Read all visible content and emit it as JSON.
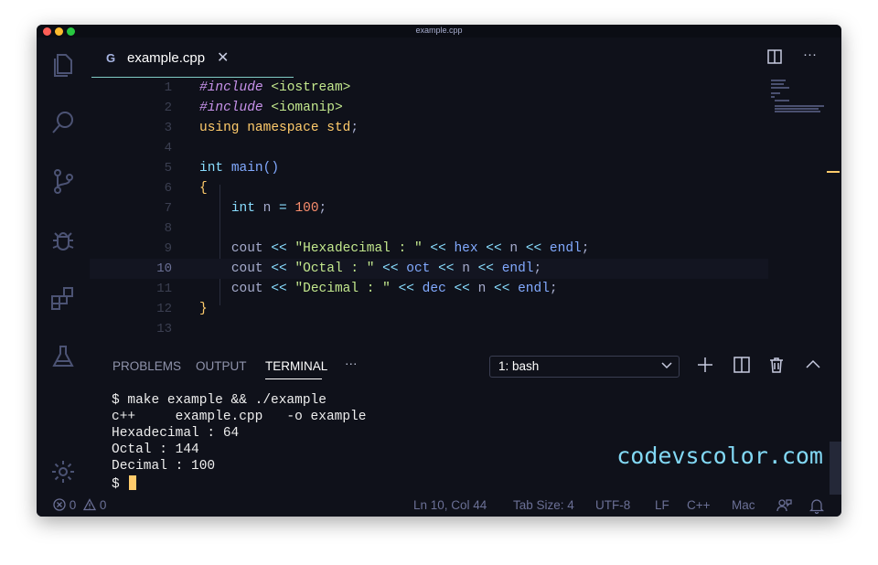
{
  "window": {
    "title": "example.cpp"
  },
  "tab": {
    "label": "example.cpp",
    "icon": "cpp-file-icon",
    "close": "✕"
  },
  "editor": {
    "current_line": 10,
    "lines": [
      {
        "num": "1"
      },
      {
        "num": "2"
      },
      {
        "num": "3"
      },
      {
        "num": "4"
      },
      {
        "num": "5"
      },
      {
        "num": "6"
      },
      {
        "num": "7"
      },
      {
        "num": "8"
      },
      {
        "num": "9"
      },
      {
        "num": "10"
      },
      {
        "num": "11"
      },
      {
        "num": "12"
      },
      {
        "num": "13"
      }
    ],
    "code": {
      "l1_dir": "#include",
      "l1_inc": "<iostream>",
      "l2_dir": "#include",
      "l2_inc": "<iomanip>",
      "l3_using": "using",
      "l3_ns": "namespace",
      "l3_std": "std",
      "l5_int": "int",
      "l5_main": "main",
      "l7_int": "int",
      "l7_n": "n",
      "l7_val": "100",
      "l9_str": "\"Hexadecimal : \"",
      "l9_manip": "hex",
      "l10_str": "\"Octal : \"",
      "l10_manip": "oct",
      "l11_str": "\"Decimal : \"",
      "l11_manip": "dec",
      "cout": "cout",
      "endl": "endl",
      "op": "<<",
      "eq": "=",
      "n": "n",
      "semi": ";",
      "paren": "()",
      "open": "{",
      "close": "}"
    }
  },
  "panel": {
    "tabs": [
      "PROBLEMS",
      "OUTPUT",
      "TERMINAL"
    ],
    "active_tab": "TERMINAL",
    "more": "···",
    "terminal_select": "1: bash"
  },
  "terminal": {
    "lines": [
      "$ make example && ./example",
      "c++     example.cpp   -o example",
      "Hexadecimal : 64",
      "Octal : 144",
      "Decimal : 100",
      "$ "
    ]
  },
  "watermark": "codevscolor.com",
  "status": {
    "errors": "0",
    "warnings": "0",
    "position": "Ln 10, Col 44",
    "tab_size": "Tab Size: 4",
    "encoding": "UTF-8",
    "eol": "LF",
    "language": "C++",
    "platform": "Mac"
  },
  "colors": {
    "background": "#0f111a",
    "accent": "#80cbc4",
    "cursor": "#ffcb6b"
  }
}
